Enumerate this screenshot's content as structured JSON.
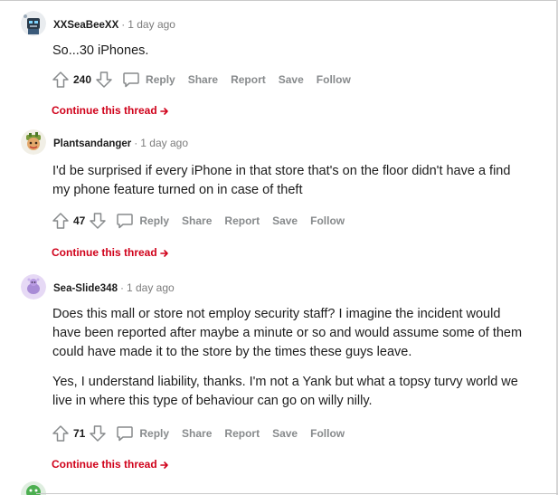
{
  "comments": [
    {
      "username": "XXSeaBeeXX",
      "separator": "·",
      "time": "1 day ago",
      "paragraphs": [
        "So...30 iPhones."
      ],
      "score": "240",
      "continue_label": "Continue this thread"
    },
    {
      "username": "Plantsandanger",
      "separator": "·",
      "time": "1 day ago",
      "paragraphs": [
        "I'd be surprised if every iPhone in that store that's on the floor didn't have a find my phone feature turned on in case of theft"
      ],
      "score": "47",
      "continue_label": "Continue this thread"
    },
    {
      "username": "Sea-Slide348",
      "separator": "·",
      "time": "1 day ago",
      "paragraphs": [
        "Does this mall or store not employ security staff? I imagine the incident would have been reported after maybe a minute or so and would assume some of them could have made it to the store by the times these guys leave.",
        "Yes, I understand liability, thanks. I'm not a Yank but what a topsy turvy world we live in where this type of behaviour can go on willy nilly."
      ],
      "score": "71",
      "continue_label": "Continue this thread"
    }
  ],
  "actions": {
    "reply": "Reply",
    "share": "Share",
    "report": "Report",
    "save": "Save",
    "follow": "Follow"
  },
  "colors": {
    "accent_red": "#d0021b",
    "meta_gray": "#7c7c7c",
    "action_gray": "#878a8c"
  },
  "icons": {
    "upvote": "upvote-arrow-icon",
    "downvote": "downvote-arrow-icon",
    "reply": "speech-bubble-icon",
    "continue": "right-arrow-icon"
  }
}
